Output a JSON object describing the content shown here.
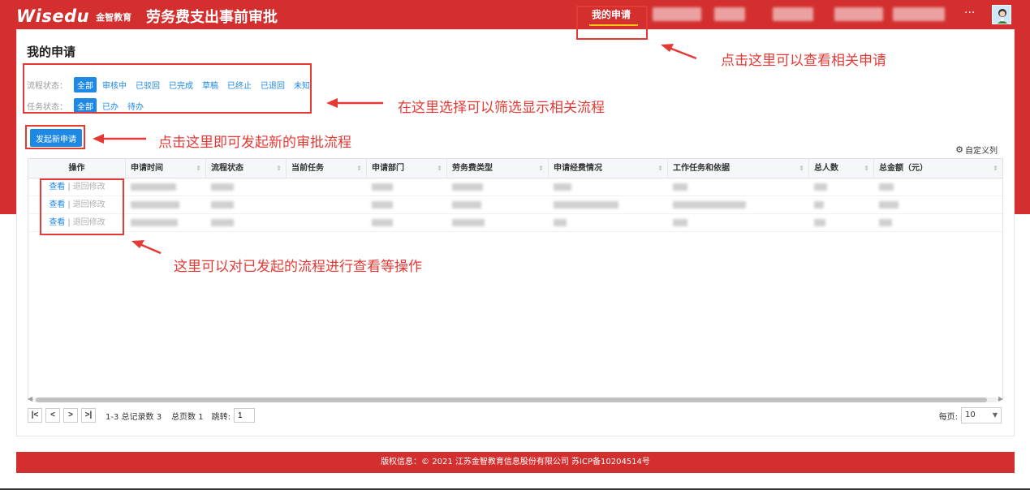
{
  "header": {
    "logo_main": "Wisedu",
    "logo_sub": "金智教育",
    "title": "劳务费支出事前审批",
    "active_nav": "我的申请",
    "more": "···"
  },
  "page": {
    "title": "我的申请",
    "process_status_label": "流程状态：",
    "process_status_chips": [
      "全部",
      "审核中",
      "已驳回",
      "已完成",
      "草稿",
      "已终止",
      "已退回",
      "未知"
    ],
    "task_status_label": "任务状态：",
    "task_status_chips": [
      "全部",
      "已办",
      "待办"
    ],
    "new_button": "发起新申请",
    "custom_columns": "自定义列"
  },
  "table": {
    "columns": [
      "操作",
      "申请时间",
      "流程状态",
      "当前任务",
      "申请部门",
      "劳务费类型",
      "申请经费情况",
      "工作任务和依据",
      "总人数",
      "总金额（元）"
    ],
    "rows": [
      {
        "view": "查看",
        "sep": "|",
        "back": "退回修改"
      },
      {
        "view": "查看",
        "sep": "|",
        "back": "退回修改"
      },
      {
        "view": "查看",
        "sep": "|",
        "back": "退回修改"
      }
    ]
  },
  "pager": {
    "range": "1-3 总记录数 3",
    "pages": "总页数 1",
    "jump_label": "跳转:",
    "jump_value": "1",
    "per_page_label": "每页:",
    "per_page_value": "10"
  },
  "footer": {
    "copyright": "版权信息：© 2021 江苏金智教育信息股份有限公司 苏ICP备10204514号"
  },
  "annotations": {
    "nav": "点击这里可以查看相关申请",
    "filter": "在这里选择可以筛选显示相关流程",
    "new": "点击这里即可发起新的审批流程",
    "ops": "这里可以对已发起的流程进行查看等操作"
  },
  "colors": {
    "brand_red": "#d32f2f",
    "accent_blue": "#1e88e5",
    "annotation_red": "#e53935"
  }
}
